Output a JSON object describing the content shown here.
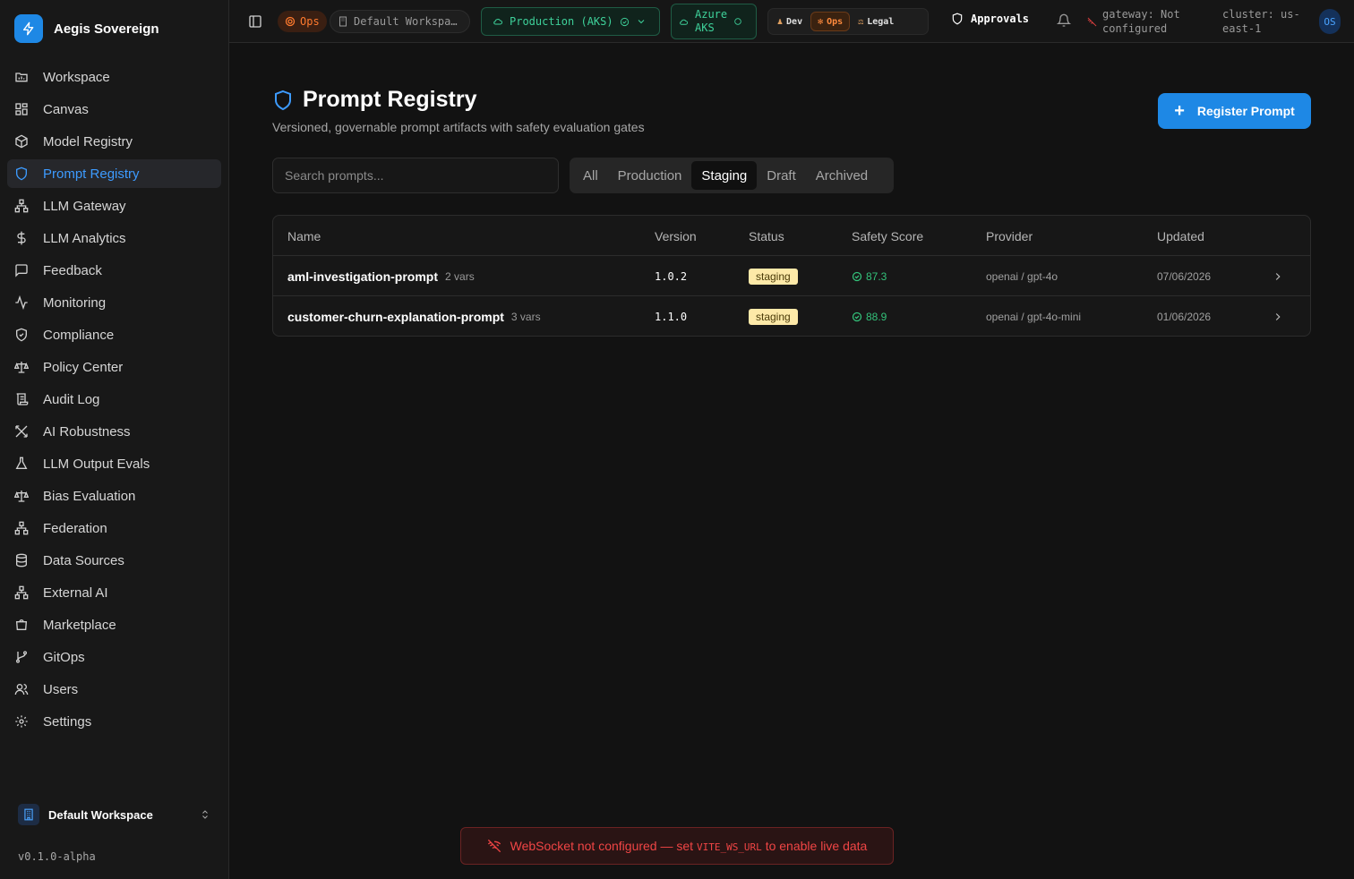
{
  "brand": {
    "name": "Aegis Sovereign"
  },
  "sidebar": {
    "items": [
      {
        "label": "Workspace",
        "icon": "folder-icon"
      },
      {
        "label": "Canvas",
        "icon": "grid-icon"
      },
      {
        "label": "Model Registry",
        "icon": "cube-icon"
      },
      {
        "label": "Prompt Registry",
        "icon": "shield-icon",
        "active": true
      },
      {
        "label": "LLM Gateway",
        "icon": "network-icon"
      },
      {
        "label": "LLM Analytics",
        "icon": "dollar-icon"
      },
      {
        "label": "Feedback",
        "icon": "message-icon"
      },
      {
        "label": "Monitoring",
        "icon": "activity-icon"
      },
      {
        "label": "Compliance",
        "icon": "shield-check-icon"
      },
      {
        "label": "Policy Center",
        "icon": "scale-icon"
      },
      {
        "label": "Audit Log",
        "icon": "scroll-icon"
      },
      {
        "label": "AI Robustness",
        "icon": "swords-icon"
      },
      {
        "label": "LLM Output Evals",
        "icon": "flask-icon"
      },
      {
        "label": "Bias Evaluation",
        "icon": "scale-icon"
      },
      {
        "label": "Federation",
        "icon": "network-icon"
      },
      {
        "label": "Data Sources",
        "icon": "database-icon"
      },
      {
        "label": "External AI",
        "icon": "network-icon"
      },
      {
        "label": "Marketplace",
        "icon": "store-icon"
      },
      {
        "label": "GitOps",
        "icon": "git-branch-icon"
      },
      {
        "label": "Users",
        "icon": "users-icon"
      },
      {
        "label": "Settings",
        "icon": "gear-icon"
      }
    ],
    "workspace": "Default Workspace",
    "version": "v0.1.0-alpha"
  },
  "topbar": {
    "ops_chip": "Ops",
    "workspace_chip": "Default Workspa…",
    "environment": "Production (AKS)",
    "cluster_chip": [
      "Azure",
      "AKS"
    ],
    "personas": [
      {
        "label": "Dev",
        "active": false
      },
      {
        "label": "Ops",
        "active": true
      },
      {
        "label": "Legal",
        "active": false
      }
    ],
    "approvals": "Approvals",
    "gateway": [
      "gateway: Not",
      "configured"
    ],
    "cluster": [
      "cluster: us-",
      "east-1"
    ],
    "avatar": "OS"
  },
  "page": {
    "title": "Prompt Registry",
    "subtitle": "Versioned, governable prompt artifacts with safety evaluation gates",
    "register_label": "Register Prompt",
    "search_placeholder": "Search prompts...",
    "tabs": [
      {
        "label": "All",
        "active": false
      },
      {
        "label": "Production",
        "active": false
      },
      {
        "label": "Staging",
        "active": true
      },
      {
        "label": "Draft",
        "active": false
      },
      {
        "label": "Archived",
        "active": false
      }
    ]
  },
  "table": {
    "columns": [
      "Name",
      "Version",
      "Status",
      "Safety Score",
      "Provider",
      "Updated"
    ],
    "rows": [
      {
        "name": "aml-investigation-prompt",
        "vars": "2 vars",
        "version": "1.0.2",
        "status": "staging",
        "safety": "87.3",
        "provider": "openai / gpt-4o",
        "updated": "07/06/2026"
      },
      {
        "name": "customer-churn-explanation-prompt",
        "vars": "3 vars",
        "version": "1.1.0",
        "status": "staging",
        "safety": "88.9",
        "provider": "openai / gpt-4o-mini",
        "updated": "01/06/2026"
      }
    ]
  },
  "toast": {
    "before": "WebSocket not configured — set",
    "code": "VITE_WS_URL",
    "after": "to enable live data"
  },
  "colors": {
    "accent": "#1e88e5",
    "active_nav": "#3d9bff",
    "success": "#33c27a",
    "error": "#f04545",
    "ops": "#ff7a2e"
  }
}
